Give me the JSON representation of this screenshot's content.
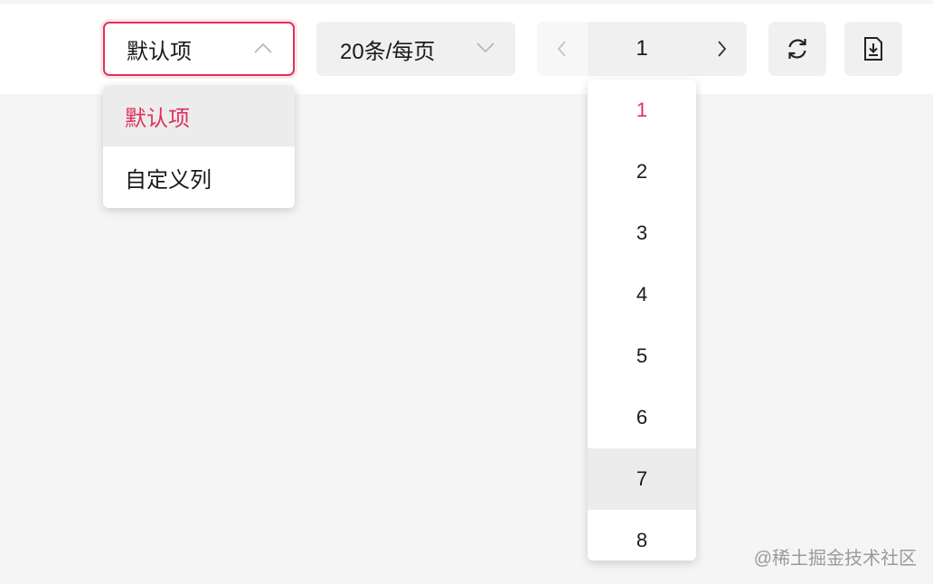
{
  "view_select": {
    "value": "默认项",
    "options": [
      "默认项",
      "自定义列"
    ]
  },
  "pagesize_select": {
    "value": "20条/每页"
  },
  "pager": {
    "current": "1",
    "pages": [
      "1",
      "2",
      "3",
      "4",
      "5",
      "6",
      "7",
      "8"
    ]
  },
  "watermark": "@稀土掘金技术社区",
  "icons": {
    "view_chevron": "chevron-up-icon",
    "pagesize_chevron": "chevron-down-icon",
    "prev": "chevron-left-icon",
    "next": "chevron-right-icon",
    "refresh": "refresh-icon",
    "export": "download-file-icon"
  },
  "colors": {
    "accent": "#e0315c",
    "button_bg": "#f0f0f0",
    "page_bg": "#f5f5f5",
    "hover_bg": "#ececec"
  }
}
